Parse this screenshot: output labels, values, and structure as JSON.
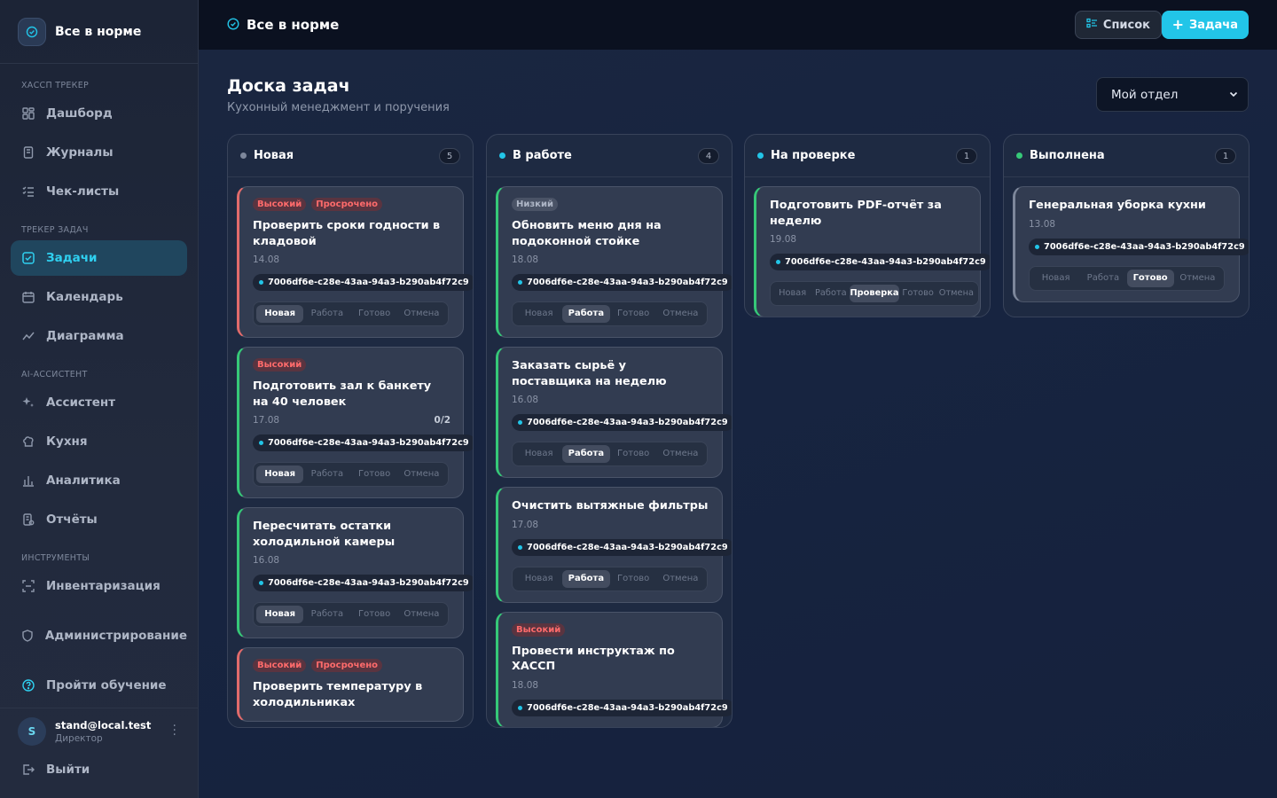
{
  "app": {
    "brand_title": "Все в норме",
    "topbar_title": "Все в норме"
  },
  "sidebar": {
    "sections": [
      {
        "label": "ХАССП ТРЕКЕР"
      },
      {
        "label": "ТРЕКЕР ЗАДАЧ"
      },
      {
        "label": "AI-АССИСТЕНТ"
      },
      {
        "label": "ИНСТРУМЕНТЫ"
      }
    ],
    "items": [
      {
        "label": "Дашборд",
        "icon": "dashboard-icon"
      },
      {
        "label": "Журналы",
        "icon": "journal-icon"
      },
      {
        "label": "Чек-листы",
        "icon": "checklist-icon"
      },
      {
        "label": "Задачи",
        "icon": "tasks-icon",
        "active": true
      },
      {
        "label": "Календарь",
        "icon": "calendar-icon"
      },
      {
        "label": "Диаграмма",
        "icon": "chart-line-icon"
      },
      {
        "label": "Ассистент",
        "icon": "sparkles-icon"
      },
      {
        "label": "Кухня",
        "icon": "chef-hat-icon"
      },
      {
        "label": "Аналитика",
        "icon": "bar-chart-icon"
      },
      {
        "label": "Отчёты",
        "icon": "report-icon"
      },
      {
        "label": "Инвентаризация",
        "icon": "scan-icon"
      },
      {
        "label": "Администрирование",
        "icon": "shield-icon"
      },
      {
        "label": "Пройти обучение",
        "icon": "help-circle-icon"
      }
    ],
    "user": {
      "initial": "S",
      "email": "stand@local.test",
      "role": "Директор"
    },
    "logout_label": "Выйти"
  },
  "toolbar": {
    "list_label": "Список",
    "task_label": "Задача"
  },
  "page": {
    "title": "Доска задач",
    "subtitle": "Кухонный менеджмент и поручения",
    "department": "Мой отдел"
  },
  "colors": {
    "accent": "#22c5e8",
    "danger": "#ff6b6b",
    "success": "#36c878",
    "new_dot": "#7d879b"
  },
  "board": {
    "task_id": "7006df6e-c28e-43aa-94a3-b290ab4f72c9",
    "status_labels": [
      "Новая",
      "Работа",
      "Готово",
      "Отмена"
    ],
    "status_labels_review": [
      "Новая",
      "Работа",
      "Проверка",
      "Готово",
      "Отмена"
    ],
    "columns": [
      {
        "title": "Новая",
        "count": "5"
      },
      {
        "title": "В работе",
        "count": "4"
      },
      {
        "title": "На проверке",
        "count": "1"
      },
      {
        "title": "Выполнена",
        "count": "1"
      }
    ],
    "cards": {
      "new_1": {
        "badges": [
          "Высокий",
          "Просрочено"
        ],
        "title": "Проверить сроки годности в кладовой",
        "date": "14.08"
      },
      "new_2": {
        "badges": [
          "Высокий"
        ],
        "title": "Подготовить зал к банкету на 40 человек",
        "date": "17.08",
        "subtasks": "0/2"
      },
      "new_3": {
        "title": "Пересчитать остатки холодильной камеры",
        "date": "16.08"
      },
      "new_4": {
        "badges": [
          "Высокий",
          "Просрочено"
        ],
        "title": "Проверить температуру в холодильниках"
      },
      "work_1": {
        "badges": [
          "Низкий"
        ],
        "title": "Обновить меню дня на подоконной стойке",
        "date": "18.08"
      },
      "work_2": {
        "title": "Заказать сырьё у поставщика на неделю",
        "date": "16.08"
      },
      "work_3": {
        "title": "Очистить вытяжные фильтры",
        "date": "17.08"
      },
      "work_4": {
        "badges": [
          "Высокий"
        ],
        "title": "Провести инструктаж по ХАССП",
        "date": "18.08"
      },
      "review_1": {
        "title": "Подготовить PDF-отчёт за неделю",
        "date": "19.08"
      },
      "done_1": {
        "title": "Генеральная уборка кухни",
        "date": "13.08"
      }
    }
  }
}
